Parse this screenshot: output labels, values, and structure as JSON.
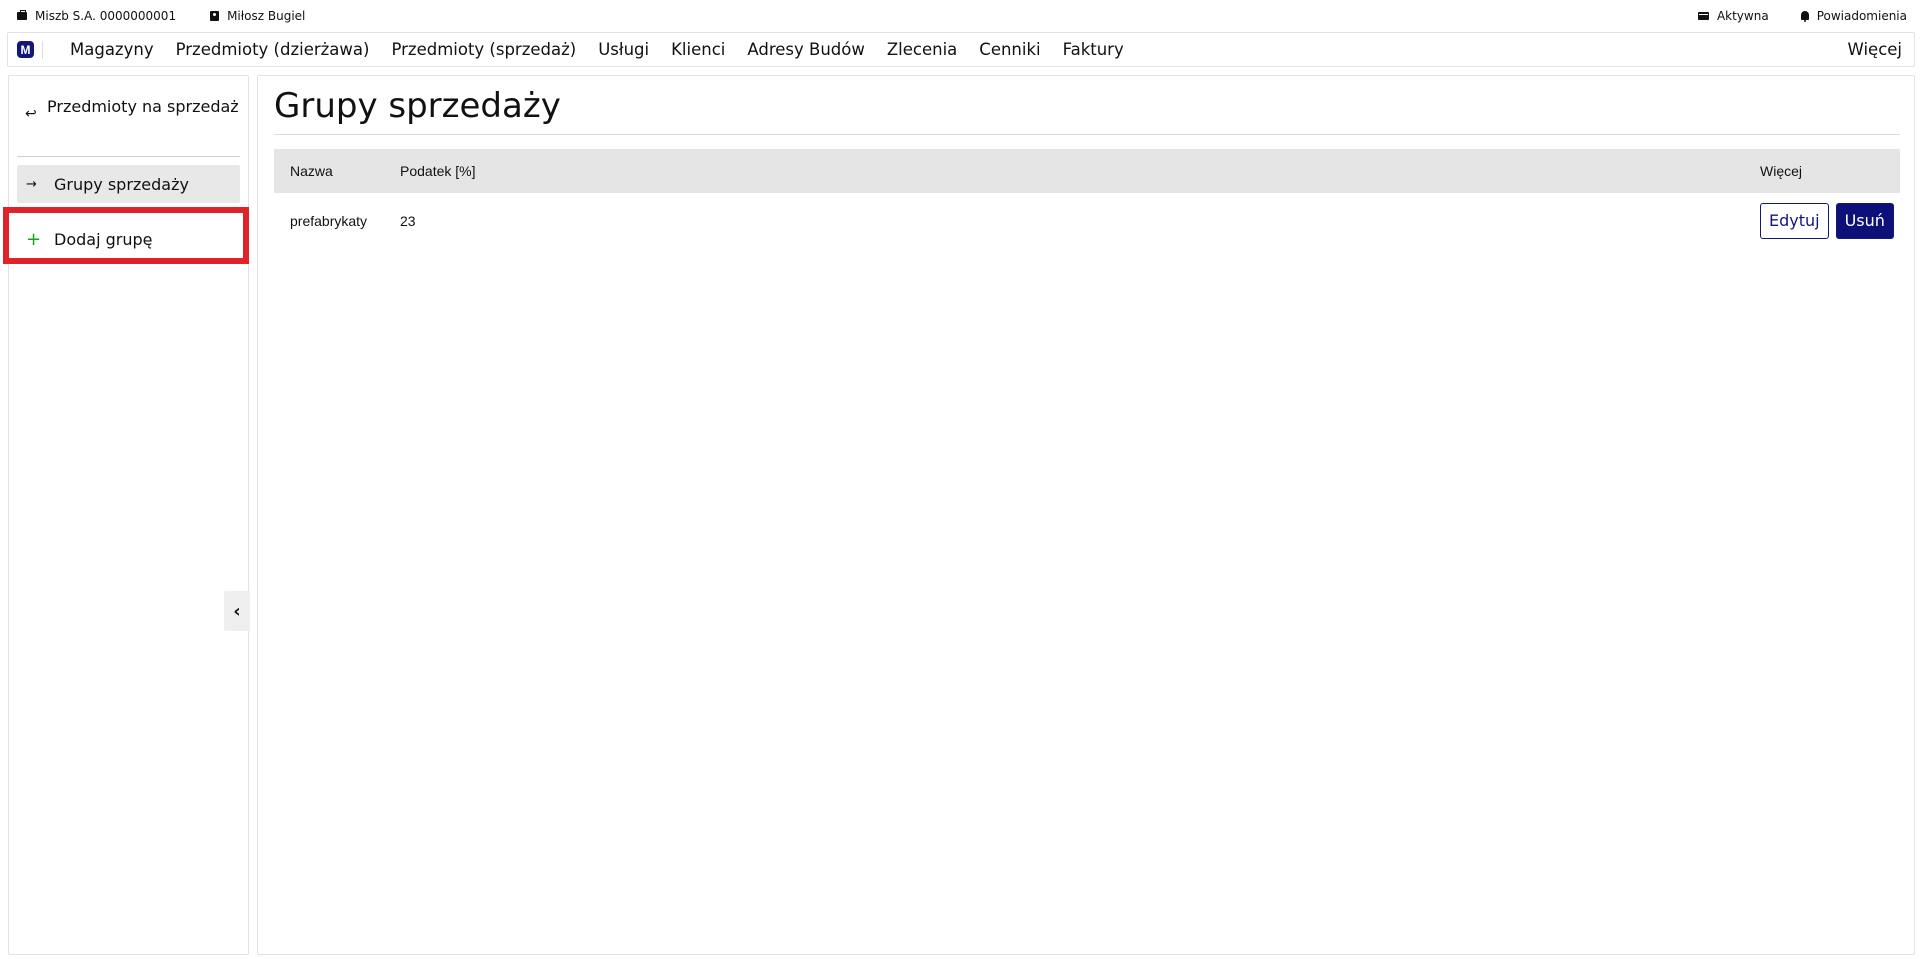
{
  "topbar": {
    "company": "Miszb S.A. 0000000001",
    "user": "Miłosz Bugiel",
    "status": "Aktywna",
    "notifications": "Powiadomienia"
  },
  "nav": {
    "logo": "M",
    "items": [
      "Magazyny",
      "Przedmioty (dzierżawa)",
      "Przedmioty (sprzedaż)",
      "Usługi",
      "Klienci",
      "Adresy Budów",
      "Zlecenia",
      "Cenniki",
      "Faktury"
    ],
    "more": "Więcej"
  },
  "sidebar": {
    "back_label": "Przedmioty na sprzedaż",
    "back_arrow": "↩",
    "items": [
      {
        "label": "Grupy sprzedaży",
        "icon": "→"
      },
      {
        "label": "Dodaj grupę",
        "icon": "+"
      }
    ],
    "collapse_icon": "‹"
  },
  "main": {
    "title": "Grupy sprzedaży",
    "table": {
      "headers": [
        "Nazwa",
        "Podatek [%]",
        "Więcej"
      ],
      "rows": [
        {
          "name": "prefabrykaty",
          "tax": "23",
          "edit": "Edytuj",
          "delete": "Usuń"
        }
      ]
    }
  },
  "colors": {
    "brand": "#13177a",
    "highlight": "#e0222b",
    "add_icon": "#1aa31a"
  }
}
